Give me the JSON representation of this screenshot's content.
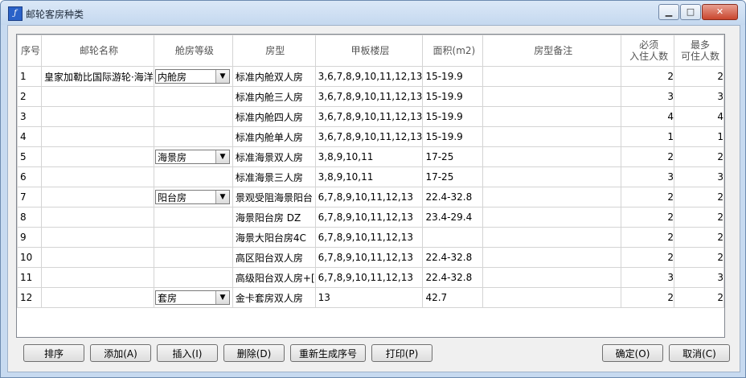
{
  "window": {
    "title": "邮轮客房种类"
  },
  "columns": [
    {
      "label": "序号"
    },
    {
      "label": "邮轮名称"
    },
    {
      "label": "舱房等级"
    },
    {
      "label": "房型"
    },
    {
      "label": "甲板楼层"
    },
    {
      "label": "面积(m2)"
    },
    {
      "label": "房型备注"
    },
    {
      "label": "必须\n入住人数"
    },
    {
      "label": "最多\n可住人数"
    }
  ],
  "ship_name": "皇家加勒比国际游轮·海洋",
  "rows": [
    {
      "no": "1",
      "cabin": "内舱房",
      "type": "标准内舱双人房",
      "deck": "3,6,7,8,9,10,11,12,13",
      "area": "15-19.9",
      "note": "",
      "min": "2",
      "max": "2"
    },
    {
      "no": "2",
      "cabin": "",
      "type": "标准内舱三人房",
      "deck": "3,6,7,8,9,10,11,12,13",
      "area": "15-19.9",
      "note": "",
      "min": "3",
      "max": "3"
    },
    {
      "no": "3",
      "cabin": "",
      "type": "标准内舱四人房",
      "deck": "3,6,7,8,9,10,11,12,13",
      "area": "15-19.9",
      "note": "",
      "min": "4",
      "max": "4"
    },
    {
      "no": "4",
      "cabin": "",
      "type": "标准内舱单人房",
      "deck": "3,6,7,8,9,10,11,12,13",
      "area": "15-19.9",
      "note": "",
      "min": "1",
      "max": "1"
    },
    {
      "no": "5",
      "cabin": "海景房",
      "type": "标准海景双人房",
      "deck": "3,8,9,10,11",
      "area": "17-25",
      "note": "",
      "min": "2",
      "max": "2"
    },
    {
      "no": "6",
      "cabin": "",
      "type": "标准海景三人房",
      "deck": "3,8,9,10,11",
      "area": "17-25",
      "note": "",
      "min": "3",
      "max": "3"
    },
    {
      "no": "7",
      "cabin": "阳台房",
      "type": "景观受阻海景阳台",
      "deck": "6,7,8,9,10,11,12,13",
      "area": "22.4-32.8",
      "note": "",
      "min": "2",
      "max": "2"
    },
    {
      "no": "8",
      "cabin": "",
      "type": "海景阳台房 DZ",
      "deck": "6,7,8,9,10,11,12,13",
      "area": "23.4-29.4",
      "note": "",
      "min": "2",
      "max": "2"
    },
    {
      "no": "9",
      "cabin": "",
      "type": "海景大阳台房4C",
      "deck": "6,7,8,9,10,11,12,13",
      "area": "",
      "note": "",
      "min": "2",
      "max": "2"
    },
    {
      "no": "10",
      "cabin": "",
      "type": "高区阳台双人房",
      "deck": "6,7,8,9,10,11,12,13",
      "area": "22.4-32.8",
      "note": "",
      "min": "2",
      "max": "2"
    },
    {
      "no": "11",
      "cabin": "",
      "type": "高级阳台双人房+[",
      "deck": "6,7,8,9,10,11,12,13",
      "area": "22.4-32.8",
      "note": "",
      "min": "3",
      "max": "3"
    },
    {
      "no": "12",
      "cabin": "套房",
      "type": "金卡套房双人房",
      "deck": "13",
      "area": "42.7",
      "note": "",
      "min": "2",
      "max": "2"
    }
  ],
  "buttons": {
    "sort": "排序",
    "add": "添加(A)",
    "insert": "插入(I)",
    "delete": "删除(D)",
    "renumber": "重新生成序号",
    "print": "打印(P)",
    "ok": "确定(O)",
    "cancel": "取消(C)"
  }
}
